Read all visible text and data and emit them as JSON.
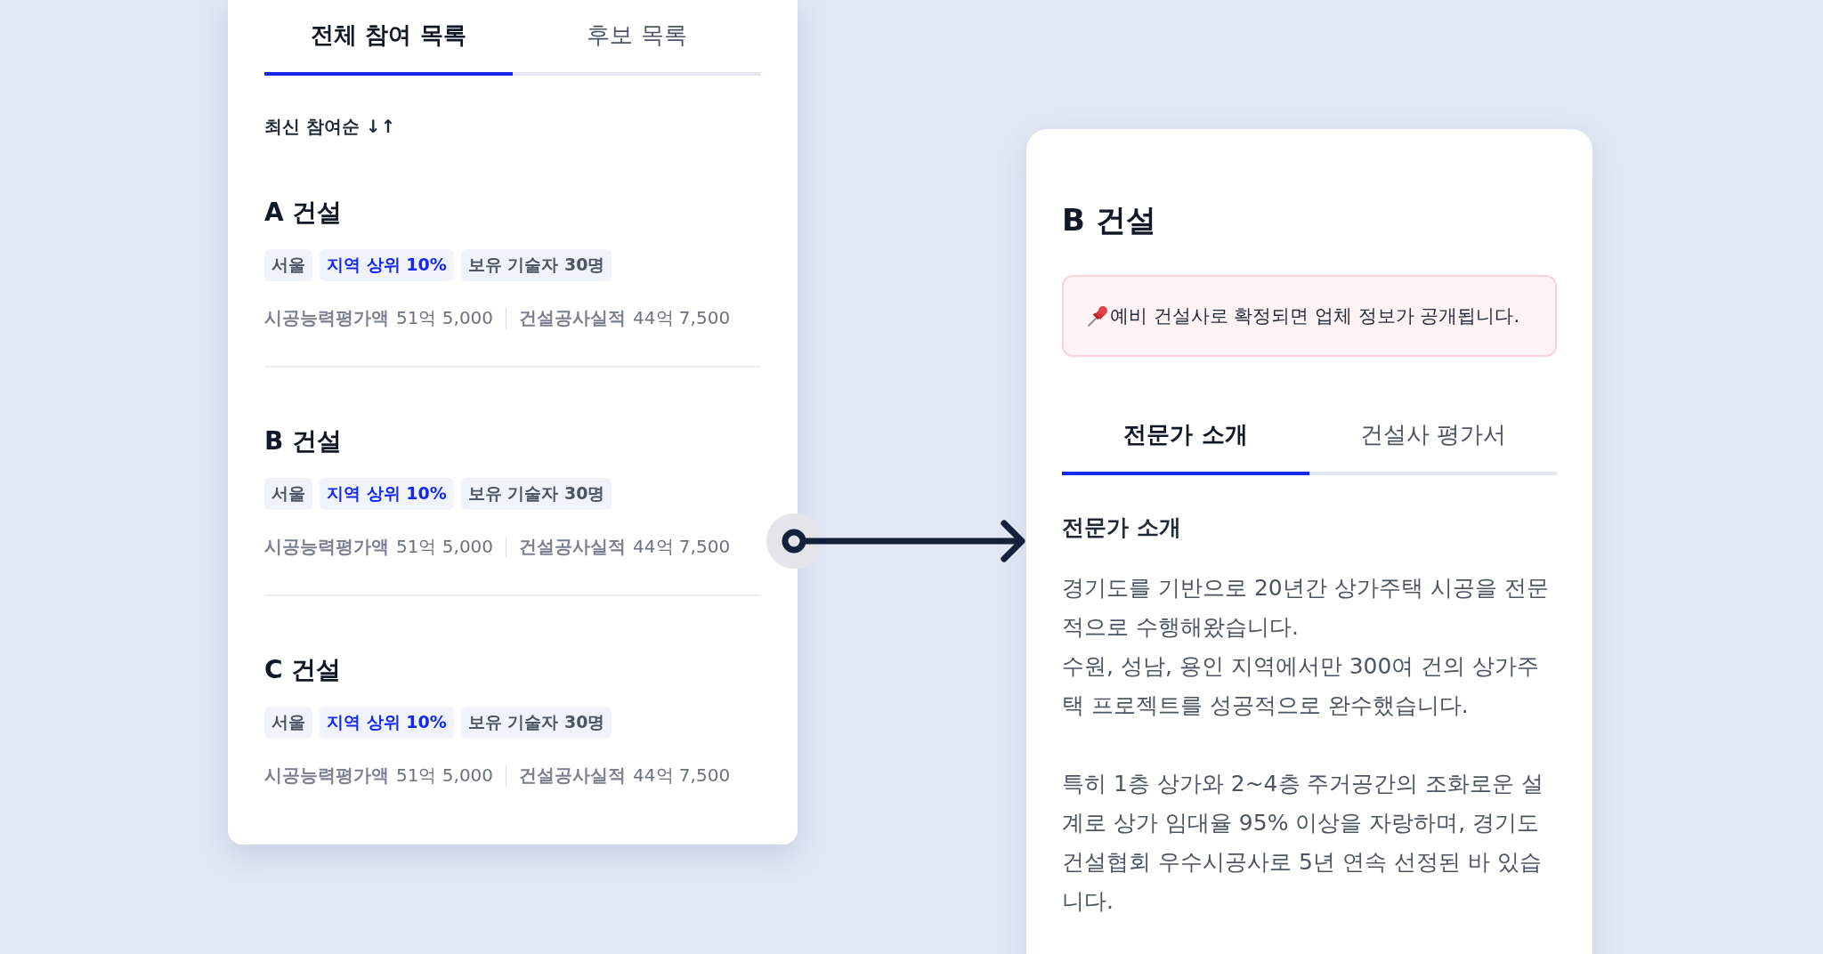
{
  "participant_list": {
    "tabs": [
      {
        "label": "전체 참여 목록",
        "selected": true
      },
      {
        "label": "후보 목록",
        "selected": false
      }
    ],
    "sort": {
      "label": "최신 참여순 ↓↑"
    },
    "companies": [
      {
        "name": "A 건설",
        "tags": [
          {
            "label": "서울",
            "kind": "plain"
          },
          {
            "label": "지역 상위 10%",
            "kind": "highlight"
          },
          {
            "label": "보유 기술자 30명",
            "kind": "plain"
          }
        ],
        "stats": [
          {
            "label": "시공능력평가액",
            "value": "51억 5,000"
          },
          {
            "label": "건설공사실적",
            "value": "44억 7,500"
          }
        ]
      },
      {
        "name": "B 건설",
        "tags": [
          {
            "label": "서울",
            "kind": "plain"
          },
          {
            "label": "지역 상위 10%",
            "kind": "highlight"
          },
          {
            "label": "보유 기술자 30명",
            "kind": "plain"
          }
        ],
        "stats": [
          {
            "label": "시공능력평가액",
            "value": "51억 5,000"
          },
          {
            "label": "건설공사실적",
            "value": "44억 7,500"
          }
        ]
      },
      {
        "name": "C 건설",
        "tags": [
          {
            "label": "서울",
            "kind": "plain"
          },
          {
            "label": "지역 상위 10%",
            "kind": "highlight"
          },
          {
            "label": "보유 기술자 30명",
            "kind": "plain"
          }
        ],
        "stats": [
          {
            "label": "시공능력평가액",
            "value": "51억 5,000"
          },
          {
            "label": "건설공사실적",
            "value": "44억 7,500"
          }
        ]
      }
    ]
  },
  "detail": {
    "title": "B 건설",
    "notice": "예비 건설사로 확정되면 업체 정보가 공개됩니다.",
    "tabs": [
      {
        "label": "전문가 소개",
        "selected": true
      },
      {
        "label": "건설사 평가서",
        "selected": false
      }
    ],
    "section_heading": "전문가 소개",
    "paragraphs": [
      [
        "경기도를 기반으로 20년간 상가주택 시공을 전문적으로 수행해왔습니다.",
        "수원, 성남, 용인 지역에서만 300여 건의 상가주택 프로젝트를 성공적으로 완수했습니다."
      ],
      [
        "특히 1층 상가와 2~4층 주거공간의 조화로운 설계로 상가 임대율 95% 이상을 자랑하며, 경기도건설협회 우수시공사로 5년 연속 선정된 바 있습니다."
      ]
    ]
  }
}
